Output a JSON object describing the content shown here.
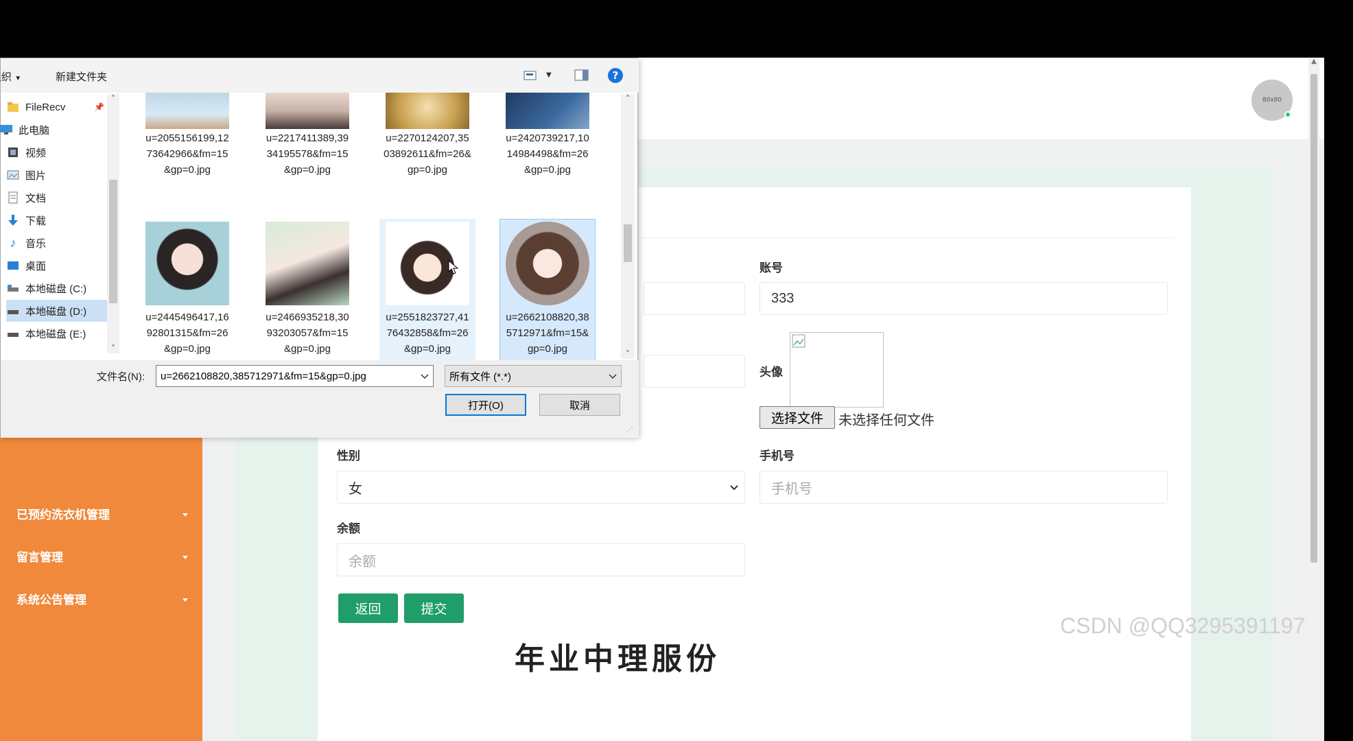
{
  "header": {
    "avatar_text": "80x80"
  },
  "sidebar": {
    "items": [
      {
        "label": "已预约洗衣机管理"
      },
      {
        "label": "留言管理"
      },
      {
        "label": "系统公告管理"
      }
    ]
  },
  "form": {
    "account_label": "账号",
    "account_value": "333",
    "avatar_label": "头像",
    "file_button": "选择文件",
    "file_status": "未选择任何文件",
    "gender_label": "性别",
    "gender_value": "女",
    "phone_label": "手机号",
    "phone_placeholder": "手机号",
    "balance_label": "余额",
    "balance_placeholder": "余额",
    "back_button": "返回",
    "submit_button": "提交"
  },
  "watermark": "CSDN @QQ3295391197",
  "bottom_cut_text": "年业中理服份",
  "dialog": {
    "toolbar": {
      "organize": "组织",
      "new_folder": "新建文件夹"
    },
    "nav": [
      {
        "label": "FileRecv",
        "icon": "folder-icon"
      },
      {
        "label": "此电脑",
        "icon": "computer-icon"
      },
      {
        "label": "视频",
        "icon": "video-icon"
      },
      {
        "label": "图片",
        "icon": "pictures-icon"
      },
      {
        "label": "文档",
        "icon": "documents-icon"
      },
      {
        "label": "下载",
        "icon": "download-icon"
      },
      {
        "label": "音乐",
        "icon": "music-icon"
      },
      {
        "label": "桌面",
        "icon": "desktop-icon"
      },
      {
        "label": "本地磁盘 (C:)",
        "icon": "drive-icon"
      },
      {
        "label": "本地磁盘 (D:)",
        "icon": "drive-icon"
      },
      {
        "label": "本地磁盘 (E:)",
        "icon": "drive-icon"
      }
    ],
    "files_row1": [
      {
        "name": "u=2055156199,1273642966&fm=15&gp=0.jpg"
      },
      {
        "name": "u=2217411389,3934195578&fm=15&gp=0.jpg"
      },
      {
        "name": "u=2270124207,3503892611&fm=26&gp=0.jpg"
      },
      {
        "name": "u=2420739217,1014984498&fm=26&gp=0.jpg"
      }
    ],
    "files_row2": [
      {
        "name": "u=2445496417,1692801315&fm=26&gp=0.jpg"
      },
      {
        "name": "u=2466935218,3093203057&fm=15&gp=0.jpg"
      },
      {
        "name": "u=2551823727,4176432858&fm=26&gp=0.jpg"
      },
      {
        "name": "u=2662108820,385712971&fm=15&gp=0.jpg"
      }
    ],
    "filename_label": "文件名(N):",
    "filename_value": "u=2662108820,385712971&fm=15&gp=0.jpg",
    "filetype_value": "所有文件 (*.*)",
    "open_button": "打开(O)",
    "cancel_button": "取消"
  }
}
